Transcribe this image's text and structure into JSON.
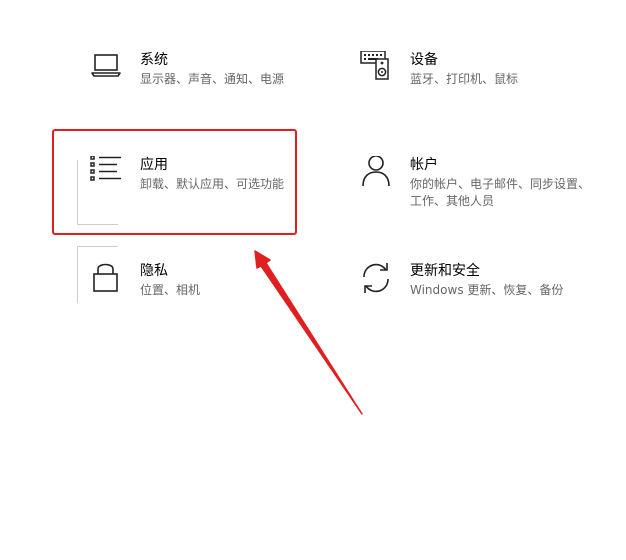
{
  "settings": {
    "tiles": [
      {
        "id": "system",
        "title": "系统",
        "desc": "显示器、声音、通知、电源",
        "icon": "laptop-icon"
      },
      {
        "id": "devices",
        "title": "设备",
        "desc": "蓝牙、打印机、鼠标",
        "icon": "keyboard-speaker-icon"
      },
      {
        "id": "apps",
        "title": "应用",
        "desc": "卸载、默认应用、可选功能",
        "icon": "app-list-icon"
      },
      {
        "id": "accounts",
        "title": "帐户",
        "desc": "你的帐户、电子邮件、同步设置、工作、其他人员",
        "icon": "person-icon"
      },
      {
        "id": "privacy",
        "title": "隐私",
        "desc": "位置、相机",
        "icon": "lock-icon"
      },
      {
        "id": "update",
        "title": "更新和安全",
        "desc": "Windows 更新、恢复、备份",
        "icon": "sync-arrows-icon"
      }
    ]
  },
  "annotation": {
    "color": "#e02020",
    "highlighted": "apps"
  }
}
